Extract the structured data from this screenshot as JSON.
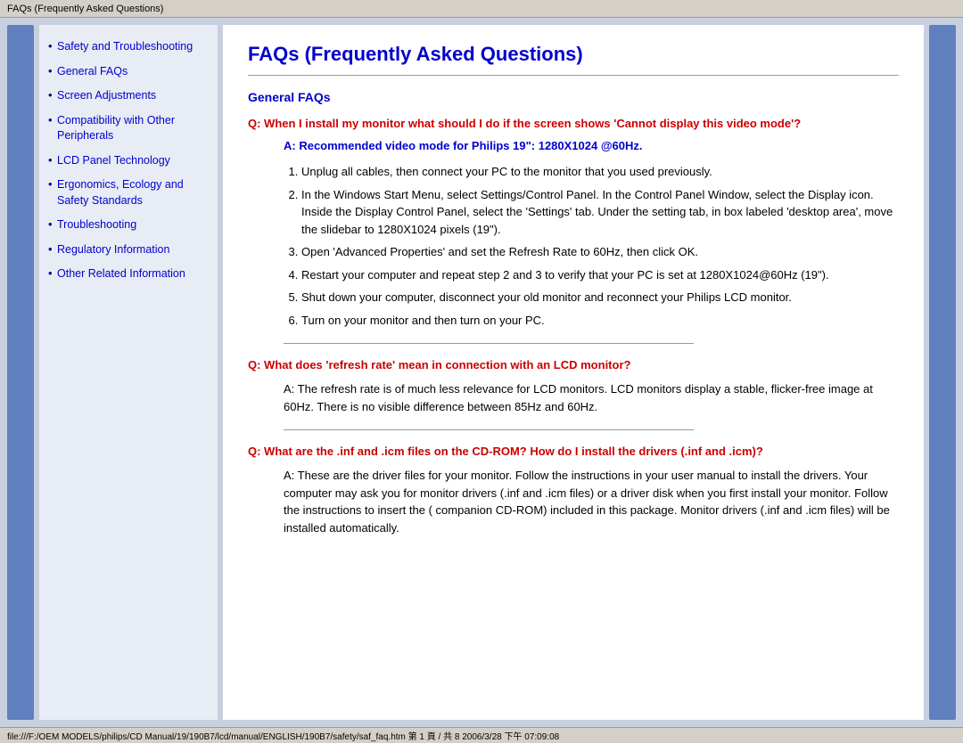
{
  "titleBar": {
    "text": "FAQs (Frequently Asked Questions)"
  },
  "sidebar": {
    "items": [
      {
        "label": "Safety and Troubleshooting",
        "href": "#"
      },
      {
        "label": "General FAQs",
        "href": "#"
      },
      {
        "label": "Screen Adjustments",
        "href": "#"
      },
      {
        "label": "Compatibility with Other Peripherals",
        "href": "#"
      },
      {
        "label": "LCD Panel Technology",
        "href": "#"
      },
      {
        "label": "Ergonomics, Ecology and Safety Standards",
        "href": "#"
      },
      {
        "label": "Troubleshooting",
        "href": "#"
      },
      {
        "label": "Regulatory Information",
        "href": "#"
      },
      {
        "label": "Other Related Information",
        "href": "#"
      }
    ]
  },
  "content": {
    "pageTitle": "FAQs (Frequently Asked Questions)",
    "sectionTitle": "General FAQs",
    "q1": {
      "question": "Q: When I install my monitor what should I do if the screen shows 'Cannot display this video mode'?",
      "answerHighlight": "A: Recommended video mode for Philips 19\": 1280X1024 @60Hz.",
      "steps": [
        "Unplug all cables, then connect your PC to the monitor that you used previously.",
        "In the Windows Start Menu, select Settings/Control Panel. In the Control Panel Window, select the Display icon. Inside the Display Control Panel, select the 'Settings' tab. Under the setting tab, in box labeled 'desktop area', move the slidebar to 1280X1024 pixels (19\").",
        "Open 'Advanced Properties' and set the Refresh Rate to 60Hz, then click OK.",
        "Restart your computer and repeat step 2 and 3 to verify that your PC is set at 1280X1024@60Hz (19\").",
        "Shut down your computer, disconnect your old monitor and reconnect your Philips LCD monitor.",
        "Turn on your monitor and then turn on your PC."
      ]
    },
    "q2": {
      "question": "Q: What does 'refresh rate' mean in connection with an LCD monitor?",
      "answerText": "A: The refresh rate is of much less relevance for LCD monitors. LCD monitors display a stable, flicker-free image at 60Hz. There is no visible difference between 85Hz and 60Hz."
    },
    "q3": {
      "question": "Q: What are the .inf and .icm files on the CD-ROM? How do I install the drivers (.inf and .icm)?",
      "answerText": "A: These are the driver files for your monitor. Follow the instructions in your user manual to install the drivers. Your computer may ask you for monitor drivers (.inf and .icm files) or a driver disk when you first install your monitor. Follow the instructions to insert the ( companion CD-ROM) included in this package. Monitor drivers (.inf and .icm files) will be installed automatically."
    }
  },
  "statusBar": {
    "text": "file:///F:/OEM MODELS/philips/CD Manual/19/190B7/lcd/manual/ENGLISH/190B7/safety/saf_faq.htm 第 1 頁 / 共 8 2006/3/28 下午 07:09:08"
  }
}
